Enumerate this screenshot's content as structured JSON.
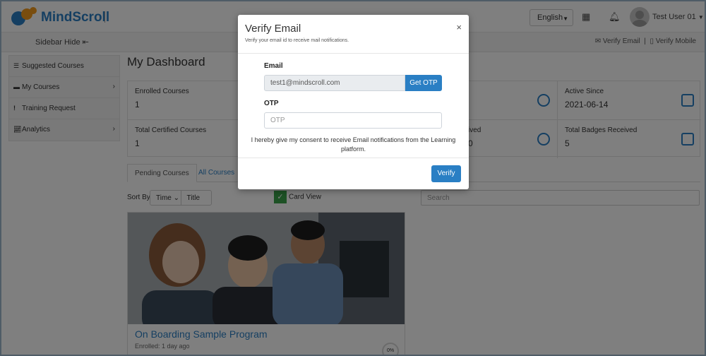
{
  "header": {
    "brand": "MindScroll",
    "language": "English",
    "user_name": "Test User 01"
  },
  "subbar": {
    "sidebar_hide": "Sidebar Hide",
    "verify_email": "Verify Email",
    "separator": "|",
    "verify_mobile": "Verify Mobile"
  },
  "sidebar": {
    "items": [
      {
        "label": "Suggested Courses"
      },
      {
        "label": "My Courses"
      },
      {
        "label": "Training Request"
      },
      {
        "label": "Analytics"
      }
    ]
  },
  "main": {
    "title": "My Dashboard",
    "stats": [
      {
        "label": "Enrolled Courses",
        "value": "1"
      },
      {
        "label": "Active Since",
        "value": "2021-06-14"
      },
      {
        "label": "Total Certified Courses",
        "value": "1"
      },
      {
        "label": "ived",
        "value": "0"
      },
      {
        "label": "Total Badges Received",
        "value": "5"
      }
    ],
    "tabs": {
      "pending": "Pending Courses",
      "all": "All Courses"
    },
    "sort_by": "Sort By",
    "sort_time": "Time",
    "sort_title": "Title",
    "card_view": "Card View",
    "search_placeholder": "Search",
    "course": {
      "title": "On Boarding Sample Program",
      "meta": "Enrolled: 1 day ago",
      "progress": "0%"
    }
  },
  "modal": {
    "title": "Verify Email",
    "subtitle": "Verify your email id to receive mail notifications.",
    "close": "×",
    "email_label": "Email",
    "email_value": "test1@mindscroll.com",
    "get_otp": "Get OTP",
    "otp_label": "OTP",
    "otp_placeholder": "OTP",
    "consent": "I hereby give my consent to receive Email notifications from the Learning platform.",
    "verify": "Verify"
  }
}
